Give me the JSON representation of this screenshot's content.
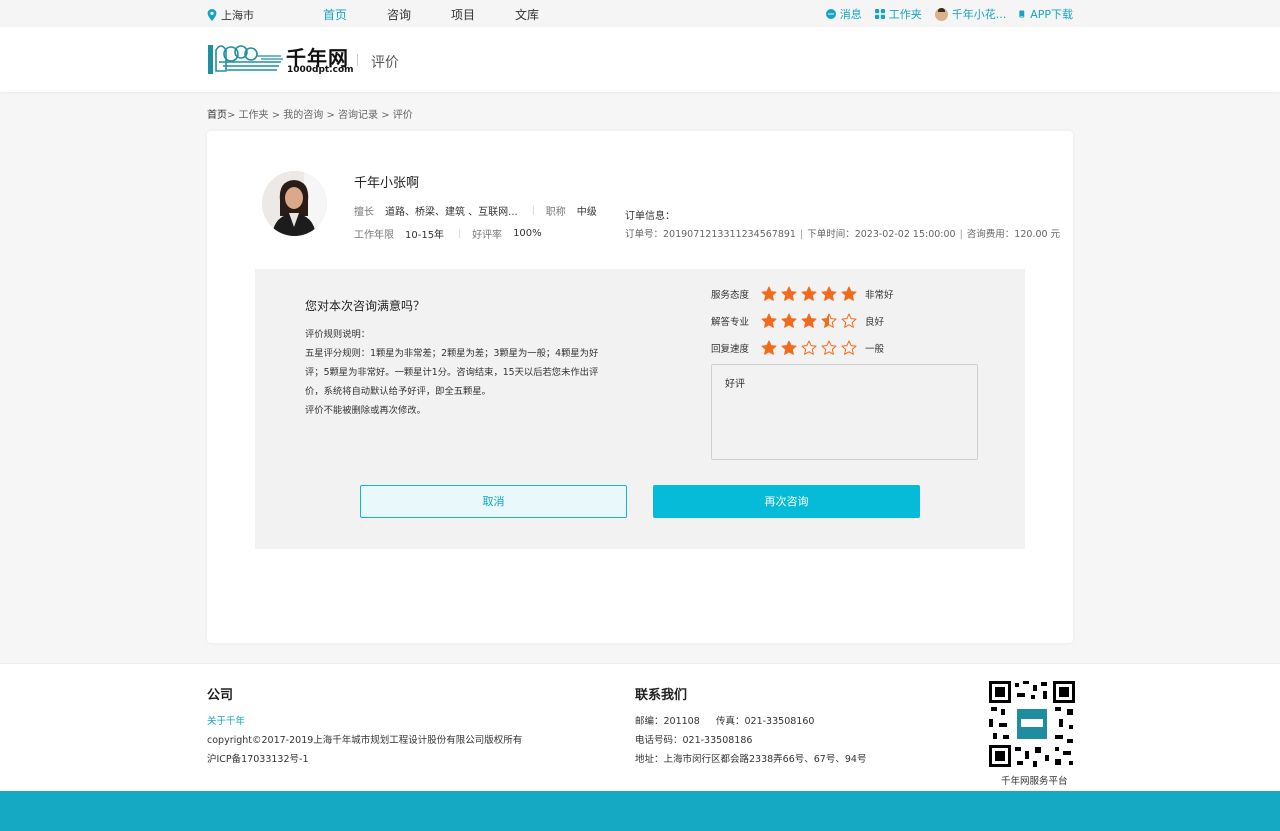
{
  "topbar": {
    "location": "上海市",
    "nav": [
      {
        "label": "首页",
        "active": true
      },
      {
        "label": "咨询",
        "active": false
      },
      {
        "label": "项目",
        "active": false
      },
      {
        "label": "文库",
        "active": false
      }
    ],
    "messages": "消息",
    "workspace": "工作夹",
    "user": "千年小花...",
    "app_download": "APP下载"
  },
  "header": {
    "logo_name": "千年网",
    "logo_url": "1000dpt.com",
    "page_name": "评价"
  },
  "breadcrumb": {
    "items": [
      "首页",
      "工作夹",
      "我的咨询",
      "咨询记录",
      "评价"
    ],
    "text_0": "首页",
    "text_rest": "> 工作夹 > 我的咨询 > 咨询记录 > 评价"
  },
  "expert": {
    "name": "千年小张啊",
    "specialty_label": "擅长",
    "specialty_value": "道路、桥梁、建筑 、互联网...",
    "title_label": "职称",
    "title_value": "中级",
    "years_label": "工作年限",
    "years_value": "10-15年",
    "rate_label": "好评率",
    "rate_value": "100%"
  },
  "order": {
    "title": "订单信息：",
    "number": "订单号：2019071213311234567891",
    "time": "下单时间：2023-02-02 15:00:00",
    "fee": "咨询费用：120.00 元"
  },
  "evaluation": {
    "question": "您对本次咨询满意吗？",
    "rules_title": "评价规则说明：",
    "rules_body": "五星评分规则：1颗星为非常差；2颗星为差；3颗星为一般；4颗星为好评；5颗星为非常好。一颗星计1分。咨询结束，15天以后若您未作出评价，系统将自动默认给予好评，即全五颗星。",
    "rules_note": "评价不能被删除或再次修改。",
    "ratings": [
      {
        "label": "服务态度",
        "score": 5,
        "text": "非常好"
      },
      {
        "label": "解答专业",
        "score": 3.5,
        "text": "良好"
      },
      {
        "label": "回复速度",
        "score": 2,
        "text": "一般"
      }
    ],
    "comment": "好评",
    "cancel_label": "取消",
    "again_label": "再次咨询",
    "star_color": "#f26b1d"
  },
  "footer": {
    "company_title": "公司",
    "about": "关于千年",
    "copyright": "copyright©2017-2019上海千年城市规划工程设计股份有限公司版权所有",
    "icp": "沪ICP备17033132号-1",
    "contact_title": "联系我们",
    "postcode": "邮编：201108",
    "fax": "传真：021-33508160",
    "phone": "电话号码：021-33508186",
    "address": "地址：上海市闵行区都会路2338弄66号、67号、94号",
    "qr_caption": "千年网服务平台"
  },
  "colors": {
    "accent": "#14a5c4",
    "button": "#05bbd7",
    "bottom_bar": "#15a9c3"
  }
}
